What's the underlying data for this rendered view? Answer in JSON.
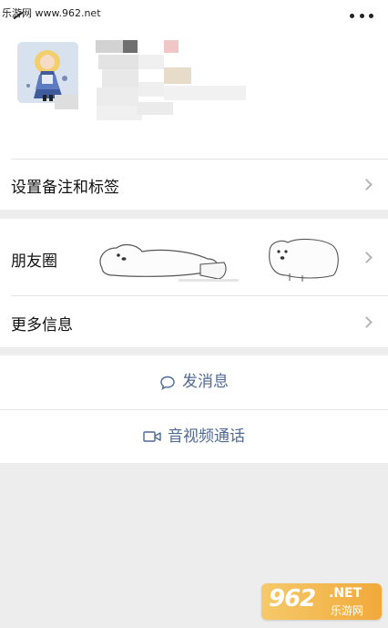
{
  "watermark": {
    "text": "乐游网 www.962.net"
  },
  "header": {
    "more_icon": "more-dots-icon"
  },
  "profile": {
    "avatar_icon": "avatar-image"
  },
  "menu": {
    "remark_tags": "设置备注和标签",
    "moments": "朋友圈",
    "more_info": "更多信息"
  },
  "actions": {
    "send_message": "发消息",
    "video_call": "音视频通话"
  },
  "logo": {
    "number": "962",
    "net": ".NET",
    "sub": "乐游网"
  },
  "colors": {
    "action_text": "#4f6a93",
    "chevron": "#b5b5b5",
    "background": "#ededed"
  }
}
